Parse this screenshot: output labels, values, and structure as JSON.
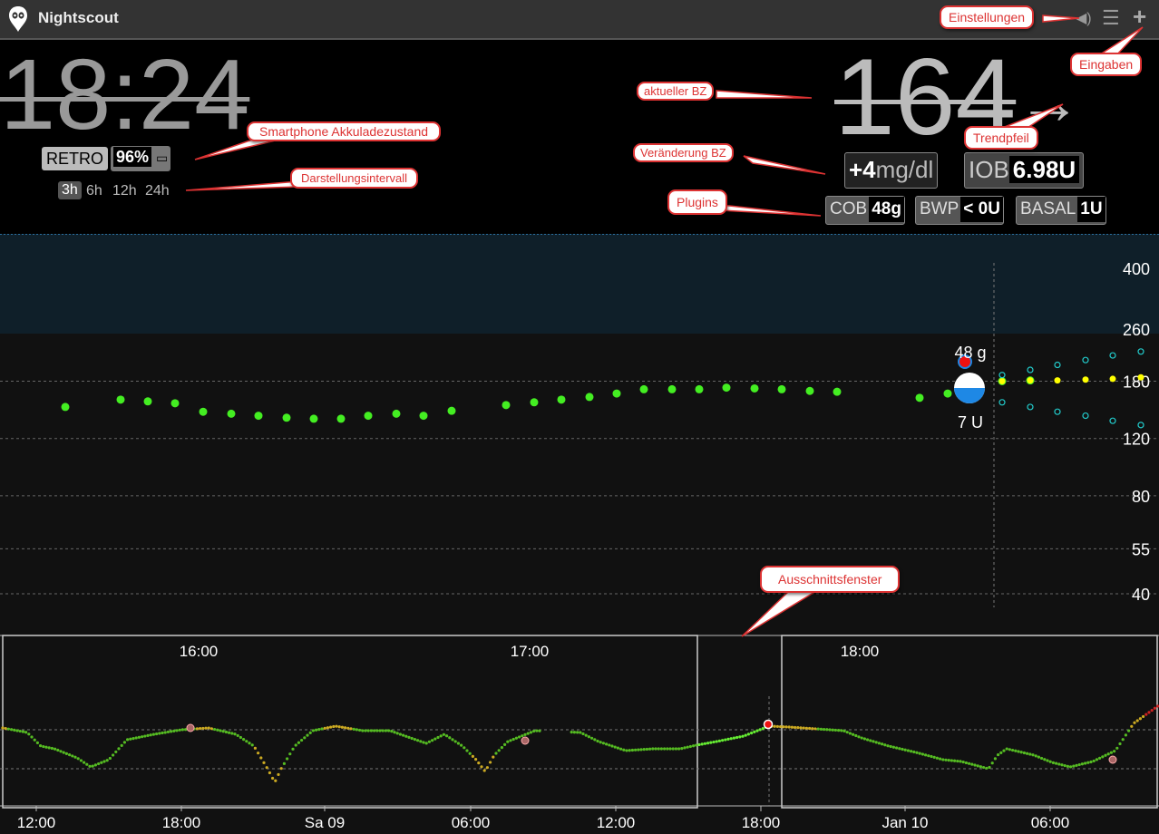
{
  "app": {
    "title": "Nightscout"
  },
  "status": {
    "clock": "18:24",
    "retro": "RETRO",
    "battery": "96%",
    "intervals": [
      "3h",
      "6h",
      "12h",
      "24h"
    ],
    "active_interval": "3h"
  },
  "reading": {
    "bg": "164",
    "trend_arrow": "→",
    "delta": "+4",
    "units": "mg/dl",
    "iob_label": "IOB",
    "iob_value": "6.98U"
  },
  "plugins": [
    {
      "label": "COB",
      "value": "48g"
    },
    {
      "label": "BWP",
      "value": "< 0U"
    },
    {
      "label": "BASAL",
      "value": "1U"
    }
  ],
  "chart_data": [
    {
      "type": "scatter",
      "title": "",
      "y_ticks": [
        400,
        260,
        180,
        120,
        80,
        55,
        40
      ],
      "y_scale": "log",
      "ylim": [
        36,
        430
      ],
      "target_range": [
        0,
        260
      ],
      "annotations": {
        "carbs": "48 g",
        "insulin": "7 U"
      },
      "series": [
        {
          "values": [
            150,
            158,
            156,
            154,
            145,
            143,
            141,
            139,
            138,
            138,
            141,
            143,
            141,
            146,
            152,
            155,
            158,
            161,
            165,
            170,
            170,
            170,
            172,
            171,
            170,
            168,
            167,
            160,
            165,
            180,
            181
          ]
        },
        {
          "values": [
            180,
            181,
            181,
            182,
            183,
            185
          ]
        },
        {
          "values": [
            188,
            195,
            202,
            209,
            216,
            222
          ]
        },
        {
          "values": [
            155,
            150,
            145,
            141,
            136,
            132
          ]
        }
      ],
      "colors": {
        "bg": "#44ee22",
        "forecast": "#ffff00",
        "cone": "#22cccc",
        "carbs": "#ee1111",
        "insulin": "#1e88e5"
      }
    },
    {
      "type": "line",
      "title": "",
      "x_ticks_top": [
        "16:00",
        "17:00",
        "18:00"
      ],
      "x_ticks_bottom": [
        "12:00",
        "18:00",
        "Sa 09",
        "06:00",
        "12:00",
        "18:00",
        "Jan 10",
        "06:00"
      ],
      "colors": {
        "in_range": "#55bb22",
        "high": "#ccaa22",
        "very_high": "#cc2222"
      }
    }
  ],
  "annotations": {
    "einstellungen": "Einstellungen",
    "eingaben": "Eingaben",
    "aktueller_bz": "aktueller BZ",
    "smartphone": "Smartphone Akkuladezustand",
    "trendpfeil": "Trendpfeil",
    "veraenderung": "Veränderung BZ",
    "darstellung": "Darstellungsintervall",
    "plugins": "Plugins",
    "ausschnitt": "Ausschnittsfenster"
  }
}
